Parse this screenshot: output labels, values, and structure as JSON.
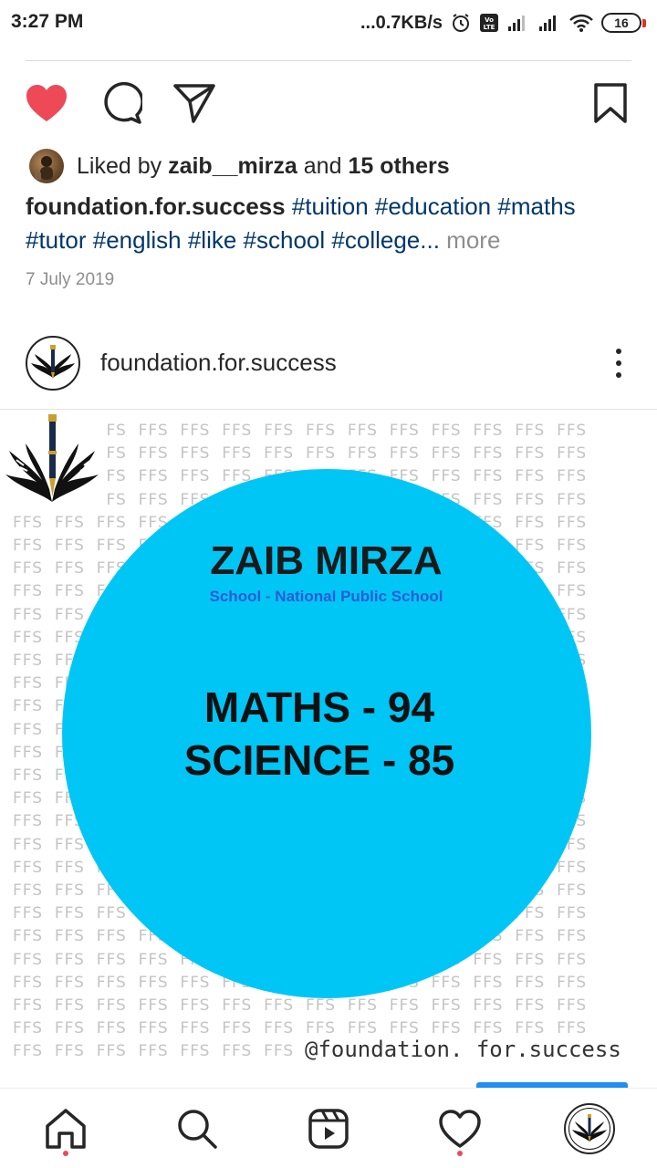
{
  "status_bar": {
    "time": "3:27 PM",
    "network_speed": "...0.7KB/s",
    "battery": "16",
    "icons": [
      "alarm-icon",
      "volte-icon",
      "signal-icon",
      "signal-icon",
      "wifi-icon",
      "battery-icon"
    ]
  },
  "actions": {
    "like_icon": "heart-filled-icon",
    "comment_icon": "comment-icon",
    "share_icon": "send-icon",
    "save_icon": "bookmark-icon",
    "like_color": "#ed4956"
  },
  "likes": {
    "prefix": "Liked by",
    "user": "zaib__mirza",
    "middle": "and",
    "others": "15 others"
  },
  "caption": {
    "username": "foundation.for.success",
    "tags": [
      "#tuition",
      "#education",
      "#maths",
      "#tutor",
      "#english",
      "#like",
      "#school",
      "#college"
    ],
    "ellipsis": "...",
    "more": "more"
  },
  "date": "7 July 2019",
  "post": {
    "username": "foundation.for.success",
    "image": {
      "pattern_text": "FFS",
      "name": "ZAIB MIRZA",
      "school": "School - National Public School",
      "score_line_1": "MATHS - 94",
      "score_line_2": "SCIENCE - 85",
      "handle": "@foundation. for.success",
      "circle_color": "#00c6f5"
    }
  },
  "bottom_nav": {
    "items": [
      "home-icon",
      "search-icon",
      "reels-icon",
      "activity-heart-icon",
      "profile-avatar"
    ],
    "dot_color": "#ed4956"
  }
}
